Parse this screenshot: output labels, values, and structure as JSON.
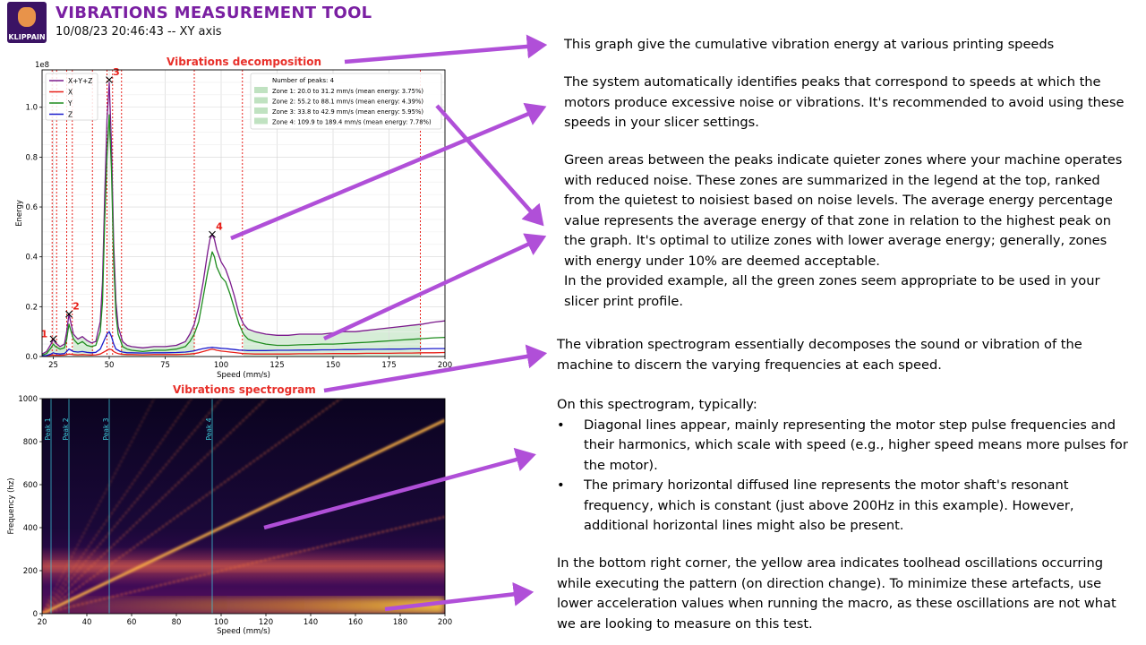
{
  "header": {
    "logo_text": "KLIPPAIN",
    "title": "VIBRATIONS MEASUREMENT TOOL",
    "subtitle": "10/08/23 20:46:43 -- XY axis"
  },
  "annotations": {
    "para1": "This graph give the cumulative vibration energy at various printing speeds",
    "para2": "The system automatically identifies peaks that correspond to speeds at which the motors produce excessive noise or vibrations. It's recommended to avoid using these speeds in your slicer settings.",
    "para3": "Green areas between the peaks indicate quieter zones where your machine operates with reduced noise. These zones are summarized in the legend at the top, ranked from the quietest to noisiest based on noise levels. The average energy percentage value represents the average energy of that zone in relation to the highest peak on the graph. It's optimal to utilize zones with lower average energy; generally, zones with energy under 10% are deemed acceptable.",
    "para3b": "In the provided example, all the green zones seem appropriate to be used in your slicer print profile.",
    "para4": "The vibration spectrogram essentially decomposes the sound or vibration of the machine to discern the varying frequencies at each speed.",
    "para5": "On this spectrogram, typically:",
    "bullet_symbol": "•",
    "bullet1": "Diagonal lines appear, mainly representing the motor step pulse frequencies and their harmonics, which scale with speed (e.g., higher speed means more pulses for the motor).",
    "bullet2": "The primary horizontal diffused line represents the motor shaft's resonant frequency, which is constant (just above 200Hz in this example). However, additional horizontal lines might also be present.",
    "para6": "In the bottom right corner, the yellow area indicates toolhead oscillations occurring while executing the pattern (on direction change). To minimize these artefacts, use lower acceleration values when running the macro, as these oscillations are not what we are looking to measure on this test."
  },
  "colors": {
    "title": "#7a1fa2",
    "plot_title": "#e8302a",
    "arrow": "#b04fd8",
    "xyz": "#7b1a8c",
    "x": "#e8201a",
    "y": "#1e8c1e",
    "z": "#1c1ccc",
    "zone": "#a5d6a7"
  },
  "chart_data": [
    {
      "type": "line",
      "title": "Vibrations decomposition",
      "xlabel": "Speed (mm/s)",
      "ylabel": "Energy",
      "y_scale_label": "1e8",
      "xlim": [
        20,
        200
      ],
      "ylim": [
        0,
        1.15
      ],
      "x_ticks": [
        25,
        50,
        75,
        100,
        125,
        150,
        175,
        200
      ],
      "y_ticks": [
        0.0,
        0.2,
        0.4,
        0.6,
        0.8,
        1.0
      ],
      "grid": true,
      "legend_placement": "top-left",
      "x": [
        20,
        22,
        24,
        25,
        26,
        28,
        30,
        31,
        32,
        33,
        34,
        36,
        38,
        40,
        42,
        44,
        46,
        47,
        48,
        49,
        50,
        51,
        52,
        53,
        54,
        55,
        56,
        58,
        60,
        65,
        70,
        75,
        80,
        84,
        86,
        88,
        90,
        92,
        94,
        95,
        96,
        97,
        98,
        100,
        102,
        104,
        106,
        108,
        110,
        112,
        115,
        120,
        125,
        130,
        135,
        140,
        145,
        150,
        155,
        160,
        165,
        170,
        175,
        180,
        185,
        190,
        195,
        200
      ],
      "series": [
        {
          "name": "X+Y+Z",
          "values": [
            0.01,
            0.02,
            0.05,
            0.07,
            0.055,
            0.04,
            0.05,
            0.1,
            0.17,
            0.13,
            0.09,
            0.07,
            0.08,
            0.065,
            0.055,
            0.06,
            0.14,
            0.3,
            0.65,
            0.95,
            1.1,
            0.85,
            0.45,
            0.22,
            0.12,
            0.09,
            0.06,
            0.045,
            0.04,
            0.035,
            0.04,
            0.04,
            0.045,
            0.06,
            0.09,
            0.13,
            0.2,
            0.3,
            0.42,
            0.47,
            0.49,
            0.47,
            0.43,
            0.38,
            0.35,
            0.3,
            0.24,
            0.17,
            0.13,
            0.11,
            0.1,
            0.09,
            0.085,
            0.085,
            0.09,
            0.09,
            0.09,
            0.095,
            0.1,
            0.1,
            0.105,
            0.11,
            0.115,
            0.12,
            0.125,
            0.13,
            0.138,
            0.143
          ]
        },
        {
          "name": "X",
          "values": [
            0.002,
            0.003,
            0.005,
            0.006,
            0.005,
            0.005,
            0.006,
            0.008,
            0.01,
            0.009,
            0.008,
            0.007,
            0.008,
            0.007,
            0.006,
            0.007,
            0.01,
            0.015,
            0.02,
            0.025,
            0.03,
            0.028,
            0.02,
            0.015,
            0.012,
            0.01,
            0.009,
            0.008,
            0.008,
            0.007,
            0.008,
            0.008,
            0.008,
            0.009,
            0.01,
            0.012,
            0.015,
            0.02,
            0.025,
            0.028,
            0.03,
            0.028,
            0.025,
            0.022,
            0.02,
            0.018,
            0.016,
            0.014,
            0.012,
            0.011,
            0.01,
            0.01,
            0.01,
            0.01,
            0.011,
            0.011,
            0.011,
            0.012,
            0.012,
            0.012,
            0.013,
            0.013,
            0.013,
            0.014,
            0.014,
            0.015,
            0.015,
            0.016
          ]
        },
        {
          "name": "Y",
          "values": [
            0.006,
            0.012,
            0.035,
            0.05,
            0.04,
            0.03,
            0.035,
            0.07,
            0.13,
            0.1,
            0.07,
            0.05,
            0.06,
            0.045,
            0.04,
            0.045,
            0.1,
            0.22,
            0.55,
            0.8,
            0.97,
            0.75,
            0.38,
            0.17,
            0.09,
            0.065,
            0.04,
            0.03,
            0.025,
            0.02,
            0.025,
            0.025,
            0.03,
            0.04,
            0.06,
            0.09,
            0.14,
            0.24,
            0.34,
            0.38,
            0.42,
            0.4,
            0.36,
            0.32,
            0.3,
            0.25,
            0.19,
            0.13,
            0.09,
            0.07,
            0.06,
            0.05,
            0.045,
            0.045,
            0.047,
            0.048,
            0.05,
            0.05,
            0.052,
            0.055,
            0.057,
            0.06,
            0.063,
            0.066,
            0.069,
            0.072,
            0.075,
            0.077
          ]
        },
        {
          "name": "Z",
          "values": [
            0.003,
            0.004,
            0.01,
            0.015,
            0.012,
            0.01,
            0.012,
            0.02,
            0.03,
            0.025,
            0.02,
            0.018,
            0.02,
            0.017,
            0.015,
            0.017,
            0.03,
            0.05,
            0.07,
            0.09,
            0.1,
            0.08,
            0.05,
            0.03,
            0.025,
            0.02,
            0.018,
            0.015,
            0.015,
            0.014,
            0.015,
            0.015,
            0.016,
            0.018,
            0.02,
            0.023,
            0.028,
            0.032,
            0.035,
            0.036,
            0.037,
            0.036,
            0.035,
            0.033,
            0.032,
            0.03,
            0.028,
            0.026,
            0.025,
            0.024,
            0.024,
            0.024,
            0.025,
            0.025,
            0.026,
            0.026,
            0.027,
            0.027,
            0.028,
            0.028,
            0.029,
            0.029,
            0.03,
            0.03,
            0.031,
            0.031,
            0.032,
            0.032
          ]
        }
      ],
      "peaks": [
        {
          "label": "1",
          "x": 25,
          "y": 0.07
        },
        {
          "label": "2",
          "x": 32,
          "y": 0.17
        },
        {
          "label": "3",
          "x": 50,
          "y": 1.11
        },
        {
          "label": "4",
          "x": 96,
          "y": 0.49
        }
      ],
      "peak_bounds": [
        24.5,
        26.5,
        31.0,
        33.5,
        42.5,
        49.0,
        51.5,
        55.5,
        88.0,
        109.5,
        189.0
      ],
      "zones": [
        {
          "label": "Zone 1: 20.0 to 31.2 mm/s (mean energy: 3.75%)",
          "start": 20.0,
          "end": 31.2
        },
        {
          "label": "Zone 2: 55.2 to 88.1 mm/s (mean energy: 4.39%)",
          "start": 55.2,
          "end": 88.1
        },
        {
          "label": "Zone 3: 33.8 to 42.9 mm/s (mean energy: 5.95%)",
          "start": 33.8,
          "end": 42.9
        },
        {
          "label": "Zone 4: 109.9 to 189.4 mm/s (mean energy: 7.78%)",
          "start": 109.9,
          "end": 189.4
        }
      ],
      "legend_header": "Number of peaks: 4"
    },
    {
      "type": "heatmap",
      "title": "Vibrations spectrogram",
      "xlabel": "Speed (mm/s)",
      "ylabel": "Frequency (hz)",
      "xlim": [
        20,
        200
      ],
      "ylim": [
        0,
        1000
      ],
      "x_ticks": [
        20,
        40,
        60,
        80,
        100,
        120,
        140,
        160,
        180,
        200
      ],
      "y_ticks": [
        0,
        200,
        400,
        600,
        800,
        1000
      ],
      "peak_lines": [
        {
          "label": "Peak 1",
          "x": 24
        },
        {
          "label": "Peak 2",
          "x": 32
        },
        {
          "label": "Peak 3",
          "x": 50
        },
        {
          "label": "Peak 4",
          "x": 96
        }
      ],
      "resonance_hz": 220,
      "diagonal_slopes_hz_per_mms": [
        2.5,
        5,
        7.5,
        10,
        12.5,
        15,
        20
      ]
    }
  ]
}
